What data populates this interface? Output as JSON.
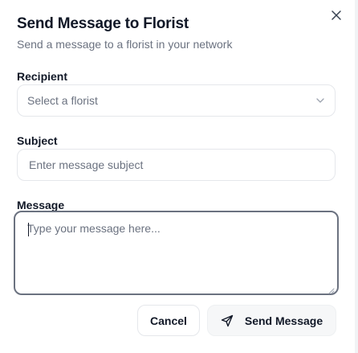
{
  "dialog": {
    "title": "Send Message to Florist",
    "subtitle": "Send a message to a florist in your network"
  },
  "recipient": {
    "label": "Recipient",
    "placeholder": "Select a florist"
  },
  "subject": {
    "label": "Subject",
    "placeholder": "Enter message subject"
  },
  "message": {
    "label": "Message",
    "placeholder": "Type your message here..."
  },
  "actions": {
    "cancel_label": "Cancel",
    "send_label": "Send Message"
  },
  "icons": {
    "close": "close-icon",
    "chevron": "chevron-down-icon",
    "send": "send-icon"
  },
  "colors": {
    "text": "#111827",
    "muted": "#6b7280",
    "border": "#e5e7eb",
    "focus_border": "#6b7280"
  }
}
